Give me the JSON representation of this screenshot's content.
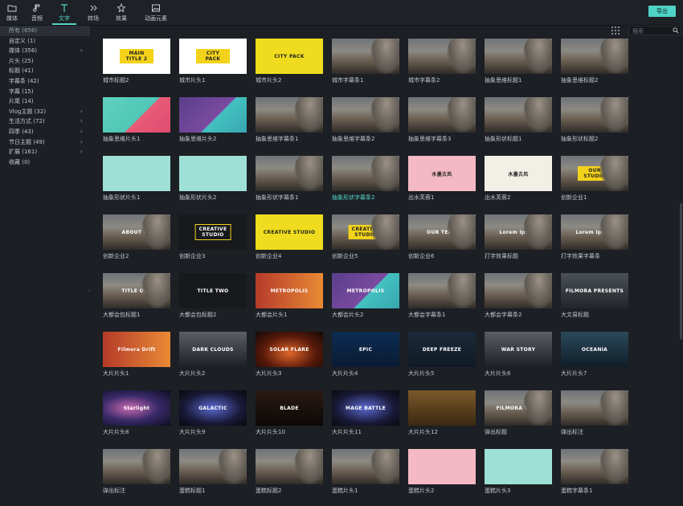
{
  "toolbar": {
    "tabs": [
      {
        "label": "媒体",
        "icon": "folder-icon",
        "active": false
      },
      {
        "label": "音频",
        "icon": "music-note-icon",
        "active": false
      },
      {
        "label": "文字",
        "icon": "text-icon",
        "active": true
      },
      {
        "label": "转场",
        "icon": "transition-icon",
        "active": false
      },
      {
        "label": "效果",
        "icon": "effects-icon",
        "active": false
      },
      {
        "label": "动画元素",
        "icon": "image-icon",
        "active": false
      }
    ],
    "export_label": "导出"
  },
  "sidebar": {
    "items": [
      {
        "label": "所有 (856)",
        "active": true,
        "expandable": false
      },
      {
        "label": "自定义 (1)",
        "active": false,
        "expandable": false
      },
      {
        "label": "媒体 (356)",
        "active": false,
        "expandable": true
      },
      {
        "label": "片头 (25)",
        "active": false,
        "expandable": false
      },
      {
        "label": "标题 (41)",
        "active": false,
        "expandable": false
      },
      {
        "label": "字幕条 (42)",
        "active": false,
        "expandable": false
      },
      {
        "label": "字幕 (15)",
        "active": false,
        "expandable": false
      },
      {
        "label": "片尾 (14)",
        "active": false,
        "expandable": false
      },
      {
        "label": "Vlog主题 (32)",
        "active": false,
        "expandable": true
      },
      {
        "label": "生活方式 (72)",
        "active": false,
        "expandable": true
      },
      {
        "label": "四季 (43)",
        "active": false,
        "expandable": true
      },
      {
        "label": "节日主题 (49)",
        "active": false,
        "expandable": true
      },
      {
        "label": "扩展 (161)",
        "active": false,
        "expandable": true
      },
      {
        "label": "收藏 (0)",
        "active": false,
        "expandable": false
      }
    ]
  },
  "search": {
    "placeholder": "搜索"
  },
  "accent": "#53d6c9",
  "grid": [
    [
      {
        "caption": "城市标题2",
        "style": "white",
        "text": "MAIN TITLE 2",
        "variant": "boxy"
      },
      {
        "caption": "城市片头1",
        "style": "white",
        "text": "CITY PACK",
        "variant": "boxy"
      },
      {
        "caption": "城市片头2",
        "style": "yellow",
        "text": "CITY PACK",
        "variant": "dk"
      },
      {
        "caption": "城市字幕条1",
        "style": "sky",
        "text": "",
        "variant": ""
      },
      {
        "caption": "城市字幕条2",
        "style": "sky",
        "text": "",
        "variant": ""
      },
      {
        "caption": "抽象思维标题1",
        "style": "sky",
        "text": "",
        "variant": ""
      },
      {
        "caption": "抽象思维标题2",
        "style": "sky",
        "text": "",
        "variant": ""
      }
    ],
    [
      {
        "caption": "抽象思维片头1",
        "style": "teal",
        "text": "",
        "variant": ""
      },
      {
        "caption": "抽象思维片头2",
        "style": "purple",
        "text": "",
        "variant": ""
      },
      {
        "caption": "抽象思维字幕条1",
        "style": "sky",
        "text": "",
        "variant": ""
      },
      {
        "caption": "抽象思维字幕条2",
        "style": "sky",
        "text": "",
        "variant": ""
      },
      {
        "caption": "抽象思维字幕条3",
        "style": "sky",
        "text": "",
        "variant": ""
      },
      {
        "caption": "抽象形状标题1",
        "style": "sky",
        "text": "",
        "variant": ""
      },
      {
        "caption": "抽象形状标题2",
        "style": "sky",
        "text": "",
        "variant": ""
      }
    ],
    [
      {
        "caption": "抽象形状片头1",
        "style": "mint",
        "text": "",
        "variant": ""
      },
      {
        "caption": "抽象形状片头2",
        "style": "mint",
        "text": "",
        "variant": ""
      },
      {
        "caption": "抽象形状字幕条1",
        "style": "sky",
        "text": "",
        "variant": ""
      },
      {
        "caption": "抽象形状字幕条2",
        "style": "sky",
        "text": "",
        "variant": "",
        "highlight": true
      },
      {
        "caption": "出水芙蓉1",
        "style": "pink",
        "text": "水墨古风",
        "variant": "dk"
      },
      {
        "caption": "出水芙蓉2",
        "style": "ink",
        "text": "水墨古风",
        "variant": "dk"
      },
      {
        "caption": "创新企业1",
        "style": "sky",
        "text": "OUR STUDIO",
        "variant": "boxy"
      }
    ],
    [
      {
        "caption": "创新企业2",
        "style": "sky",
        "text": "ABOUT US",
        "variant": ""
      },
      {
        "caption": "创新企业3",
        "style": "dark",
        "text": "CREATIVE STUDIO",
        "variant": "bordered"
      },
      {
        "caption": "创新企业4",
        "style": "yellow",
        "text": "CREATIVE STUDIO",
        "variant": "dk"
      },
      {
        "caption": "创新企业5",
        "style": "sky",
        "text": "CREATIVE STUDIO",
        "variant": "boxy"
      },
      {
        "caption": "创新企业6",
        "style": "sky",
        "text": "OUR TEAM",
        "variant": ""
      },
      {
        "caption": "打字效果标题",
        "style": "sky",
        "text": "Lorem Ipsum",
        "variant": ""
      },
      {
        "caption": "打字效果字幕条",
        "style": "sky",
        "text": "Lorem Ipsum",
        "variant": ""
      }
    ],
    [
      {
        "caption": "大都会包标题1",
        "style": "sky",
        "text": "TITLE ONE",
        "variant": ""
      },
      {
        "caption": "大都会包标题2",
        "style": "dark",
        "text": "TITLE TWO",
        "variant": ""
      },
      {
        "caption": "大都会片头1",
        "style": "red",
        "text": "METROPOLIS",
        "variant": ""
      },
      {
        "caption": "大都会片头2",
        "style": "purple",
        "text": "METROPOLIS",
        "variant": ""
      },
      {
        "caption": "大都会字幕条1",
        "style": "sky",
        "text": "",
        "variant": ""
      },
      {
        "caption": "大都会字幕条2",
        "style": "sky",
        "text": "",
        "variant": ""
      },
      {
        "caption": "大文易标题",
        "style": "dust",
        "text": "FILMORA PRESENTS",
        "variant": ""
      }
    ],
    [
      {
        "caption": "大片片头1",
        "style": "red",
        "text": "Filmora Drift",
        "variant": ""
      },
      {
        "caption": "大片片头2",
        "style": "storm",
        "text": "DARK CLOUDS",
        "variant": ""
      },
      {
        "caption": "大片片头3",
        "style": "fire",
        "text": "SOLAR FLARE",
        "variant": ""
      },
      {
        "caption": "大片片头4",
        "style": "blue",
        "text": "EPIC",
        "variant": ""
      },
      {
        "caption": "大片片头5",
        "style": "cyan",
        "text": "DEEP FREEZE",
        "variant": ""
      },
      {
        "caption": "大片片头6",
        "style": "storm",
        "text": "WAR STORY",
        "variant": ""
      },
      {
        "caption": "大片片头7",
        "style": "ocean",
        "text": "OCEANIA",
        "variant": ""
      }
    ],
    [
      {
        "caption": "大片片头8",
        "style": "space",
        "text": "Starlight",
        "variant": ""
      },
      {
        "caption": "大片片头9",
        "style": "galaxy",
        "text": "GALACTIC",
        "variant": ""
      },
      {
        "caption": "大片片头10",
        "style": "metal",
        "text": "BLADE",
        "variant": ""
      },
      {
        "caption": "大片片头11",
        "style": "galaxy",
        "text": "MAGE BATTLE",
        "variant": ""
      },
      {
        "caption": "大片片头12",
        "style": "gold",
        "text": "",
        "variant": ""
      },
      {
        "caption": "弹出标题",
        "style": "sky",
        "text": "FILMORA TITLE",
        "variant": ""
      },
      {
        "caption": "弹出标注",
        "style": "sky",
        "text": "",
        "variant": ""
      }
    ],
    [
      {
        "caption": "弹出标注",
        "style": "sky",
        "text": "",
        "variant": ""
      },
      {
        "caption": "蛋糕标题1",
        "style": "sky",
        "text": "",
        "variant": ""
      },
      {
        "caption": "蛋糕标题2",
        "style": "sky",
        "text": "",
        "variant": ""
      },
      {
        "caption": "蛋糕片头1",
        "style": "sky",
        "text": "",
        "variant": ""
      },
      {
        "caption": "蛋糕片头2",
        "style": "pink",
        "text": "",
        "variant": ""
      },
      {
        "caption": "蛋糕片头3",
        "style": "mint",
        "text": "",
        "variant": ""
      },
      {
        "caption": "蛋糕字幕条1",
        "style": "sky",
        "text": "",
        "variant": ""
      }
    ]
  ]
}
